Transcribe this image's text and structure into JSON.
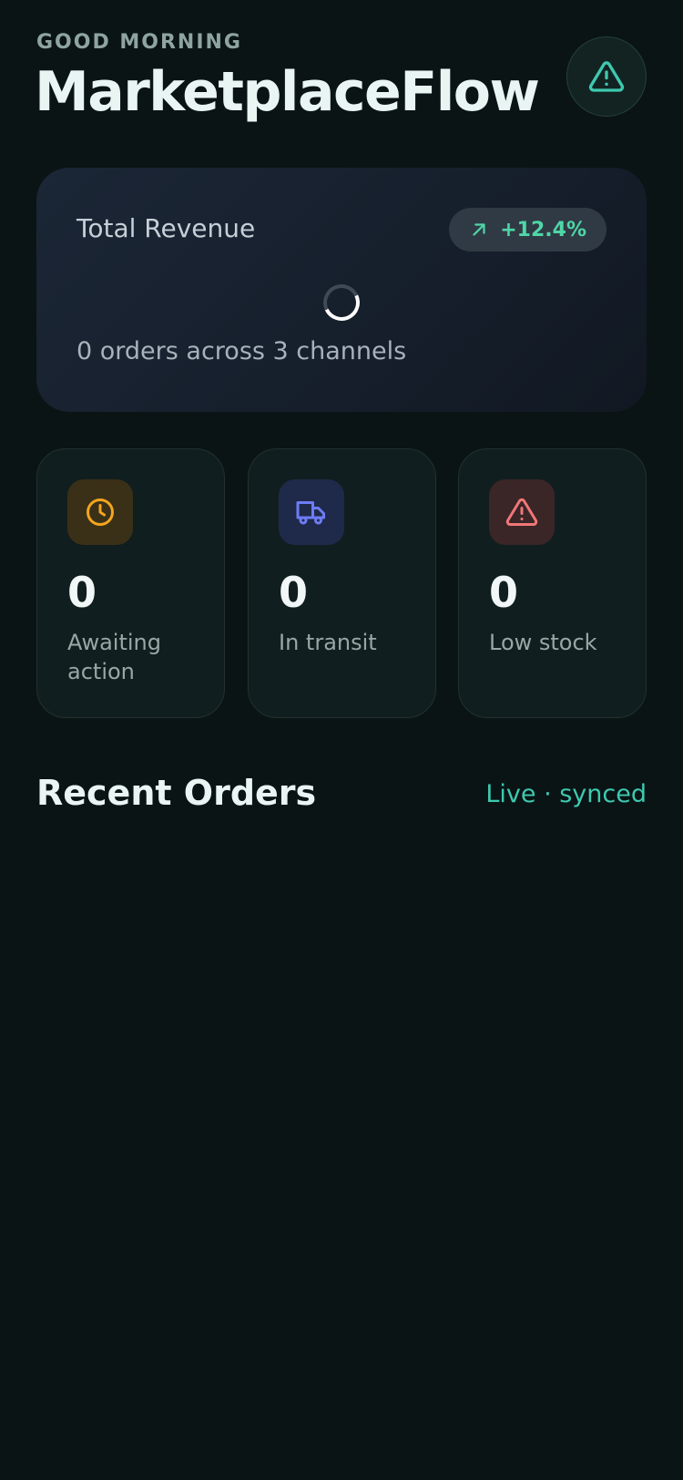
{
  "header": {
    "greeting": "GOOD MORNING",
    "title": "MarketplaceFlow",
    "alert_icon": "warning-triangle-icon"
  },
  "revenue": {
    "label": "Total Revenue",
    "delta": "+12.4%",
    "delta_icon": "arrow-up-right-icon",
    "loading": true,
    "subtitle": "0 orders across 3 channels"
  },
  "stats": [
    {
      "value": "0",
      "label": "Awaiting action",
      "icon": "clock-icon",
      "color": "#f2a51e",
      "bg": "#3a3017"
    },
    {
      "value": "0",
      "label": "In transit",
      "icon": "truck-icon",
      "color": "#6e7cf4",
      "bg": "#1f2a4a"
    },
    {
      "value": "0",
      "label": "Low stock",
      "icon": "warning-triangle-icon",
      "color": "#f07777",
      "bg": "#3a2527"
    }
  ],
  "recent_orders": {
    "title": "Recent Orders",
    "status": "Live · synced"
  },
  "colors": {
    "accent": "#3ec9b0",
    "background": "#0a1415",
    "positive": "#4fd6a7"
  }
}
